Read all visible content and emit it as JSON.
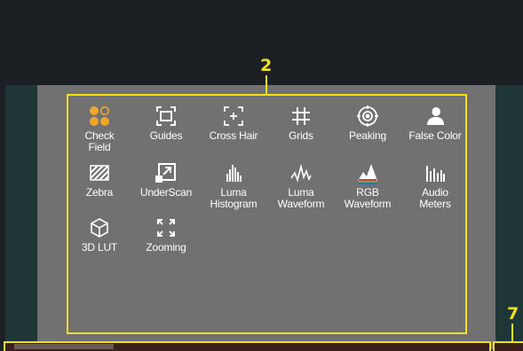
{
  "callouts": {
    "panel_number": "2",
    "side_number": "7"
  },
  "colors": {
    "accent_yellow": "#f4e01c",
    "icon_orange": "#f0a62a",
    "panel_gray": "#717171"
  },
  "tools": [
    {
      "label": "Check\nField",
      "icon": "check-field-icon"
    },
    {
      "label": "Guides",
      "icon": "guides-icon"
    },
    {
      "label": "Cross Hair",
      "icon": "cross-hair-icon"
    },
    {
      "label": "Grids",
      "icon": "grids-icon"
    },
    {
      "label": "Peaking",
      "icon": "peaking-icon"
    },
    {
      "label": "False Color",
      "icon": "false-color-icon"
    },
    {
      "label": "Zebra",
      "icon": "zebra-icon"
    },
    {
      "label": "UnderScan",
      "icon": "underscan-icon"
    },
    {
      "label": "Luma\nHistogram",
      "icon": "luma-histogram-icon"
    },
    {
      "label": "Luma\nWaveform",
      "icon": "luma-waveform-icon"
    },
    {
      "label": "RGB\nWaveform",
      "icon": "rgb-waveform-icon"
    },
    {
      "label": "Audio\nMeters",
      "icon": "audio-meters-icon"
    },
    {
      "label": "3D LUT",
      "icon": "3d-lut-icon"
    },
    {
      "label": "Zooming",
      "icon": "zooming-icon"
    }
  ]
}
